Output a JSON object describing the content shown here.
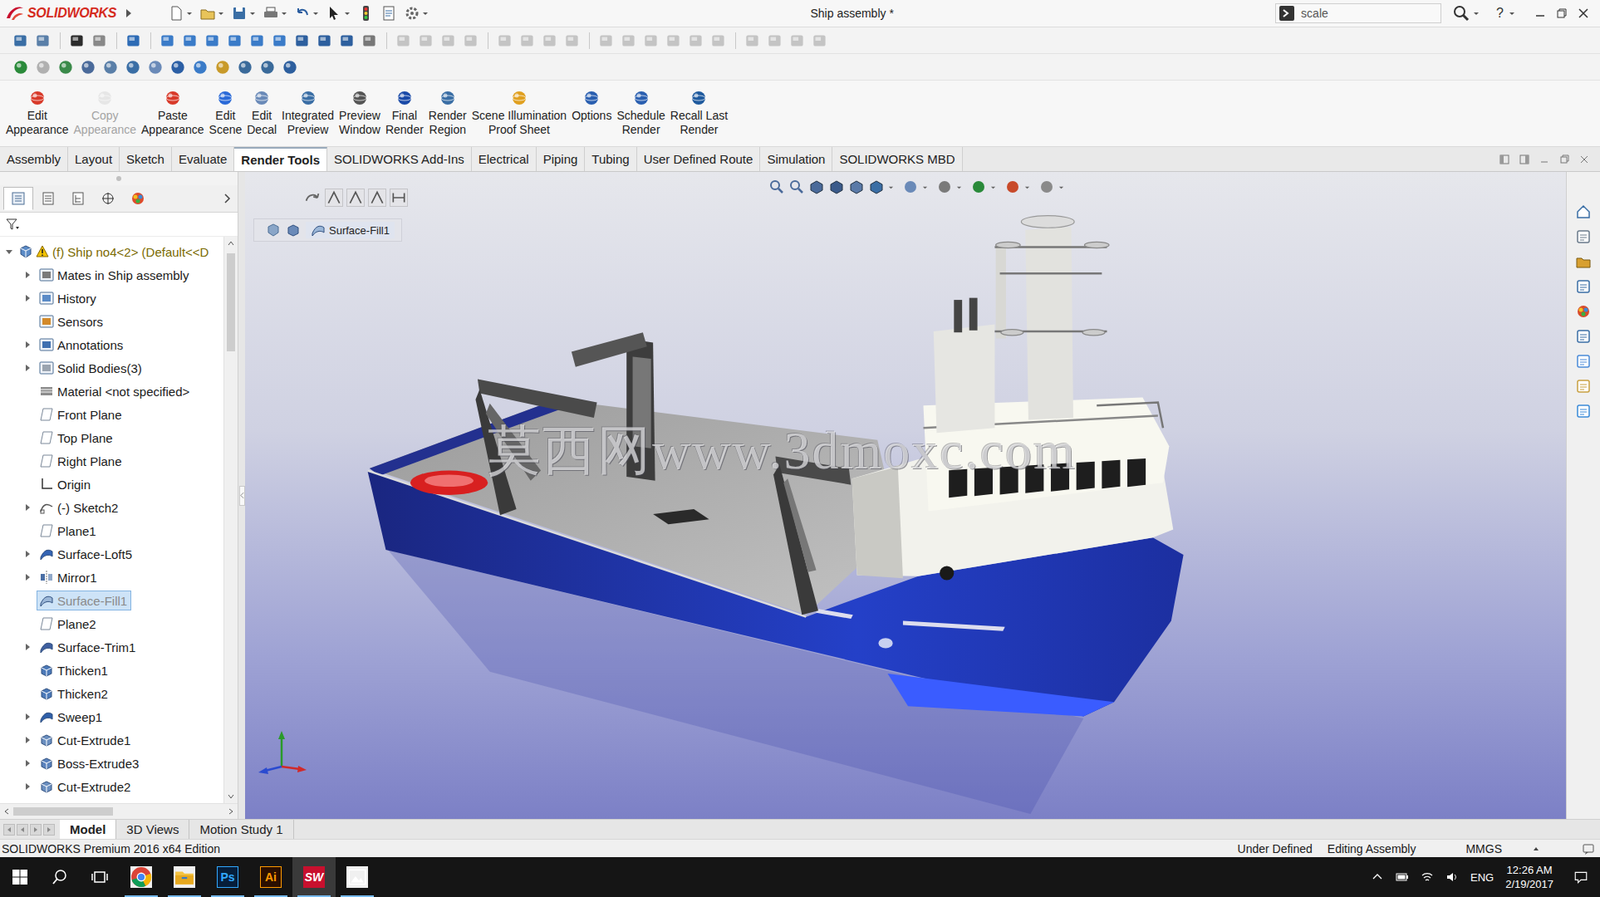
{
  "app": {
    "logo": "SOLIDWORKS",
    "title": "Ship assembly *",
    "search": "scale",
    "help": "?"
  },
  "command_buttons": [
    {
      "lines": [
        "Edit",
        "Appearance"
      ],
      "disabled": false
    },
    {
      "lines": [
        "Copy",
        "Appearance"
      ],
      "disabled": true
    },
    {
      "lines": [
        "Paste",
        "Appearance"
      ],
      "disabled": false
    },
    {
      "lines": [
        "Edit",
        "Scene"
      ],
      "disabled": false
    },
    {
      "lines": [
        "Edit",
        "Decal"
      ],
      "disabled": false
    },
    {
      "lines": [
        "Integrated",
        "Preview"
      ],
      "disabled": false
    },
    {
      "lines": [
        "Preview",
        "Window"
      ],
      "disabled": false
    },
    {
      "lines": [
        "Final",
        "Render"
      ],
      "disabled": false
    },
    {
      "lines": [
        "Render",
        "Region"
      ],
      "disabled": false
    },
    {
      "lines": [
        "Scene Illumination",
        "Proof Sheet"
      ],
      "disabled": false
    },
    {
      "lines": [
        "Options"
      ],
      "disabled": false
    },
    {
      "lines": [
        "Schedule",
        "Render"
      ],
      "disabled": false
    },
    {
      "lines": [
        "Recall Last",
        "Render"
      ],
      "disabled": false
    }
  ],
  "tabs": [
    {
      "label": "Assembly",
      "selected": false
    },
    {
      "label": "Layout",
      "selected": false
    },
    {
      "label": "Sketch",
      "selected": false
    },
    {
      "label": "Evaluate",
      "selected": false
    },
    {
      "label": "Render Tools",
      "selected": true
    },
    {
      "label": "SOLIDWORKS Add-Ins",
      "selected": false
    },
    {
      "label": "Electrical",
      "selected": false
    },
    {
      "label": "Piping",
      "selected": false
    },
    {
      "label": "Tubing",
      "selected": false
    },
    {
      "label": "User Defined Route",
      "selected": false
    },
    {
      "label": "Simulation",
      "selected": false
    },
    {
      "label": "SOLIDWORKS MBD",
      "selected": false
    }
  ],
  "panel_tabs": [
    {
      "selected": true
    },
    {
      "selected": false
    },
    {
      "selected": false
    },
    {
      "selected": false
    },
    {
      "selected": false
    }
  ],
  "tree": {
    "root": {
      "label": "(f) Ship no4<2> (Default<<D",
      "expanded": true,
      "warning": true
    },
    "items": [
      {
        "label": "Mates in Ship assembly",
        "kind": "mates",
        "expandable": true,
        "selected": false,
        "dimmed": false
      },
      {
        "label": "History",
        "kind": "history",
        "expandable": true,
        "selected": false,
        "dimmed": false
      },
      {
        "label": "Sensors",
        "kind": "sensors",
        "expandable": false,
        "selected": false,
        "dimmed": false
      },
      {
        "label": "Annotations",
        "kind": "annotations",
        "expandable": true,
        "selected": false,
        "dimmed": false
      },
      {
        "label": "Solid Bodies(3)",
        "kind": "solids",
        "expandable": true,
        "selected": false,
        "dimmed": false
      },
      {
        "label": "Material <not specified>",
        "kind": "material",
        "expandable": false,
        "selected": false,
        "dimmed": false
      },
      {
        "label": "Front Plane",
        "kind": "plane",
        "expandable": false,
        "selected": false,
        "dimmed": false
      },
      {
        "label": "Top Plane",
        "kind": "plane",
        "expandable": false,
        "selected": false,
        "dimmed": false
      },
      {
        "label": "Right Plane",
        "kind": "plane",
        "expandable": false,
        "selected": false,
        "dimmed": false
      },
      {
        "label": "Origin",
        "kind": "origin",
        "expandable": false,
        "selected": false,
        "dimmed": false
      },
      {
        "label": "(-) Sketch2",
        "kind": "sketch",
        "expandable": true,
        "selected": false,
        "dimmed": false
      },
      {
        "label": "Plane1",
        "kind": "plane",
        "expandable": false,
        "selected": false,
        "dimmed": false
      },
      {
        "label": "Surface-Loft5",
        "kind": "loft",
        "expandable": true,
        "selected": false,
        "dimmed": false
      },
      {
        "label": "Mirror1",
        "kind": "mirror",
        "expandable": true,
        "selected": false,
        "dimmed": false
      },
      {
        "label": "Surface-Fill1",
        "kind": "fill",
        "expandable": false,
        "selected": true,
        "dimmed": true
      },
      {
        "label": "Plane2",
        "kind": "plane",
        "expandable": false,
        "selected": false,
        "dimmed": false
      },
      {
        "label": "Surface-Trim1",
        "kind": "trim",
        "expandable": true,
        "selected": false,
        "dimmed": false
      },
      {
        "label": "Thicken1",
        "kind": "thicken",
        "expandable": false,
        "selected": false,
        "dimmed": false
      },
      {
        "label": "Thicken2",
        "kind": "thicken",
        "expandable": false,
        "selected": false,
        "dimmed": false
      },
      {
        "label": "Sweep1",
        "kind": "sweep",
        "expandable": true,
        "selected": false,
        "dimmed": false
      },
      {
        "label": "Cut-Extrude1",
        "kind": "cut",
        "expandable": true,
        "selected": false,
        "dimmed": false
      },
      {
        "label": "Boss-Extrude3",
        "kind": "boss",
        "expandable": true,
        "selected": false,
        "dimmed": false
      },
      {
        "label": "Cut-Extrude2",
        "kind": "cut",
        "expandable": true,
        "selected": false,
        "dimmed": false
      }
    ]
  },
  "breadcrumb": "Surface-Fill1",
  "watermark": "莫西网www.3dmoxc.com",
  "bottom_tabs": [
    {
      "label": "Model",
      "selected": true
    },
    {
      "label": "3D Views",
      "selected": false
    },
    {
      "label": "Motion Study 1",
      "selected": false
    }
  ],
  "status": {
    "edition": "SOLIDWORKS Premium 2016 x64 Edition",
    "fields": [
      "Under Defined",
      "Editing Assembly",
      "MMGS"
    ]
  },
  "taskbar": {
    "apps": [
      {
        "kind": "chrome",
        "selected": false
      },
      {
        "kind": "explorer",
        "selected": false
      },
      {
        "kind": "photoshop",
        "text": "Ps",
        "selected": false
      },
      {
        "kind": "illustrator",
        "text": "Ai",
        "selected": false
      },
      {
        "kind": "solidworks",
        "text": "SW",
        "selected": true
      },
      {
        "kind": "photos",
        "selected": false
      }
    ],
    "language": "ENG",
    "time": "12:26 AM",
    "date": "2/19/2017"
  }
}
